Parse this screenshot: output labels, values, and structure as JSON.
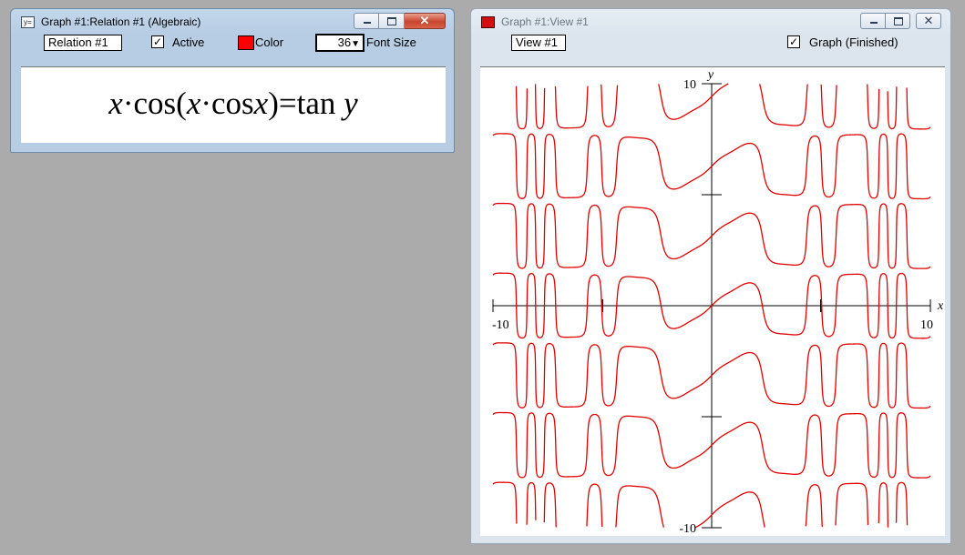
{
  "relation_window": {
    "title": "Graph #1:Relation #1 (Algebraic)",
    "icon": "equation-window-icon",
    "name_value": "Relation #1",
    "active_label": "Active",
    "active_checked": true,
    "color_label": "Color",
    "color_value": "#ff0000",
    "font_size_value": "36",
    "font_size_label": "Font Size",
    "formula": {
      "x1": "x",
      "dot1": "·",
      "cos1": "cos",
      "lparen": "(",
      "x2": "x",
      "dot2": "·",
      "cos2": "cos",
      "x3": "x",
      "rparen": ")",
      "eq": "=",
      "tan": "tan",
      "y": "y"
    }
  },
  "view_window": {
    "title": "Graph #1:View #1",
    "icon": "graph-window-icon",
    "name_value": "View #1",
    "graph_checked": true,
    "graph_label": "Graph (Finished)"
  },
  "chart_data": {
    "type": "line",
    "relation": "x·cos(x·cosx)=tan y",
    "xlabel": "x",
    "ylabel": "y",
    "xlim": [
      -10,
      10
    ],
    "ylim": [
      -10,
      10
    ],
    "x_tick_labels": [
      "-10",
      "10"
    ],
    "y_tick_labels": [
      "10",
      "-10"
    ],
    "x_ticks": [
      -10,
      -5,
      5,
      10
    ],
    "y_ticks": [
      10,
      5,
      -5,
      -10
    ],
    "curve_color": "#e00000",
    "grid": false
  }
}
